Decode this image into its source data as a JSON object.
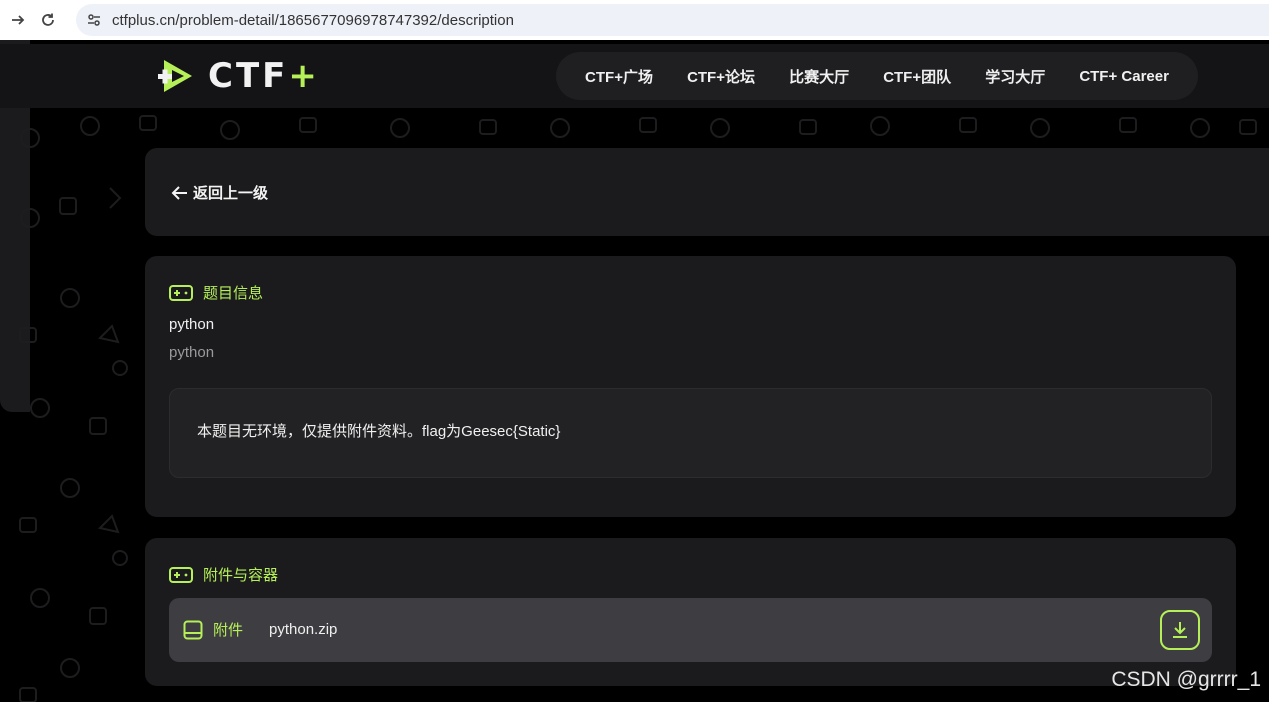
{
  "browser": {
    "url": "ctfplus.cn/problem-detail/1865677096978747392/description"
  },
  "header": {
    "logo_text": "CTF",
    "logo_plus": "+",
    "nav": [
      "CTF+广场",
      "CTF+论坛",
      "比赛大厅",
      "CTF+团队",
      "学习大厅",
      "CTF+ Career"
    ]
  },
  "back": {
    "label": "返回上一级"
  },
  "problem_info": {
    "section_title": "题目信息",
    "name": "python",
    "category": "python",
    "description": "本题目无环境，仅提供附件资料。flag为Geesec{Static}"
  },
  "attachments": {
    "section_title": "附件与容器",
    "label": "附件",
    "file_name": "python.zip"
  },
  "watermark": "CSDN @grrrr_1",
  "colors": {
    "accent": "#b6f058",
    "page_bg": "#000000",
    "card_bg": "#1b1b1d",
    "attach_row_bg": "#3d3d42"
  }
}
